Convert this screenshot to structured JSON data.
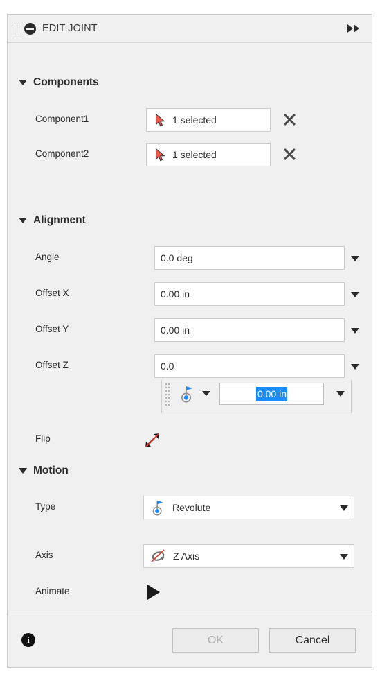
{
  "dialog": {
    "title": "EDIT JOINT",
    "collapse_icon": "minus-circle-icon",
    "grip_icon": "drag-grip-icon",
    "expand_icon": "double-right-arrow-icon"
  },
  "sections": {
    "components": {
      "title": "Components",
      "caret": "caret-down-icon",
      "rows": [
        {
          "label": "Component1",
          "value": "1 selected",
          "icon": "cursor-select-icon",
          "clear": "close-x-icon"
        },
        {
          "label": "Component2",
          "value": "1 selected",
          "icon": "cursor-select-icon",
          "clear": "close-x-icon"
        }
      ]
    },
    "alignment": {
      "title": "Alignment",
      "caret": "caret-down-icon",
      "rows": [
        {
          "label": "Angle",
          "value": "0.0 deg"
        },
        {
          "label": "Offset X",
          "value": "0.00 in"
        },
        {
          "label": "Offset Y",
          "value": "0.00 in"
        },
        {
          "label": "Offset Z",
          "value": "0.0"
        }
      ],
      "flip": {
        "label": "Flip",
        "icon": "flip-arrows-icon"
      }
    },
    "motion": {
      "title": "Motion",
      "caret": "caret-down-icon",
      "type": {
        "label": "Type",
        "value": "Revolute",
        "icon": "revolute-joint-icon"
      },
      "axis": {
        "label": "Axis",
        "value": "Z Axis",
        "icon": "rotation-axis-icon"
      },
      "animate": {
        "label": "Animate",
        "icon": "play-icon"
      }
    }
  },
  "popup": {
    "icon": "revolute-joint-icon",
    "grip": "dotted-grip-icon",
    "input_value": "0.00 in",
    "caret": "caret-down-icon"
  },
  "footer": {
    "info_icon": "info-icon",
    "info_glyph": "i",
    "ok_label": "OK",
    "cancel_label": "Cancel"
  },
  "colors": {
    "panel_bg": "#f0f0f0",
    "field_bg": "#ffffff",
    "selection_blue": "#1a8cff",
    "accent_red": "#f0564a",
    "text": "#2b2b2b"
  }
}
